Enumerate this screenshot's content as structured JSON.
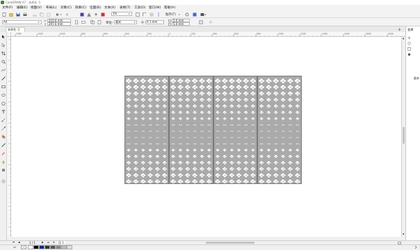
{
  "app": {
    "title": "CorelDRAW X7 - 未命名 -1"
  },
  "menu": [
    "文件(F)",
    "编辑(E)",
    "视图(V)",
    "布局(L)",
    "对象(C)",
    "效果(C)",
    "位图(B)",
    "文本(X)",
    "表格(T)",
    "工具(O)",
    "窗口(W)",
    "帮助(H)"
  ],
  "toolbar1": {
    "zoom": "1%",
    "snap_label": "贴齐(T)"
  },
  "toolbar2": {
    "paper_size": "A4",
    "width": "210.0 mm",
    "height": "297.0 mm",
    "units_label": "单位:",
    "units_value": "毫米",
    "nudge": "0.1 mm",
    "dup_x": "5.0 mm",
    "dup_y": "5.0 mm"
  },
  "doc_tab": {
    "label": "未命名 -1"
  },
  "right_panel": {
    "title": "变换",
    "label": "副本"
  },
  "ruler_labels": [
    "1400",
    "1200",
    "1000",
    "800",
    "600",
    "400",
    "200",
    "0",
    "200",
    "400",
    "600",
    "800",
    "1000",
    "1200",
    "1400",
    "1600",
    "1800",
    "2000"
  ],
  "page_nav": {
    "current": "1",
    "of": "1 / 1",
    "page_tab": "页 1"
  },
  "palette": [
    "#ffffff",
    "#000000",
    "#0a2a8a",
    "#333333",
    "#555555",
    "#888888",
    "#bbbbbb",
    "#e0e0e0"
  ]
}
